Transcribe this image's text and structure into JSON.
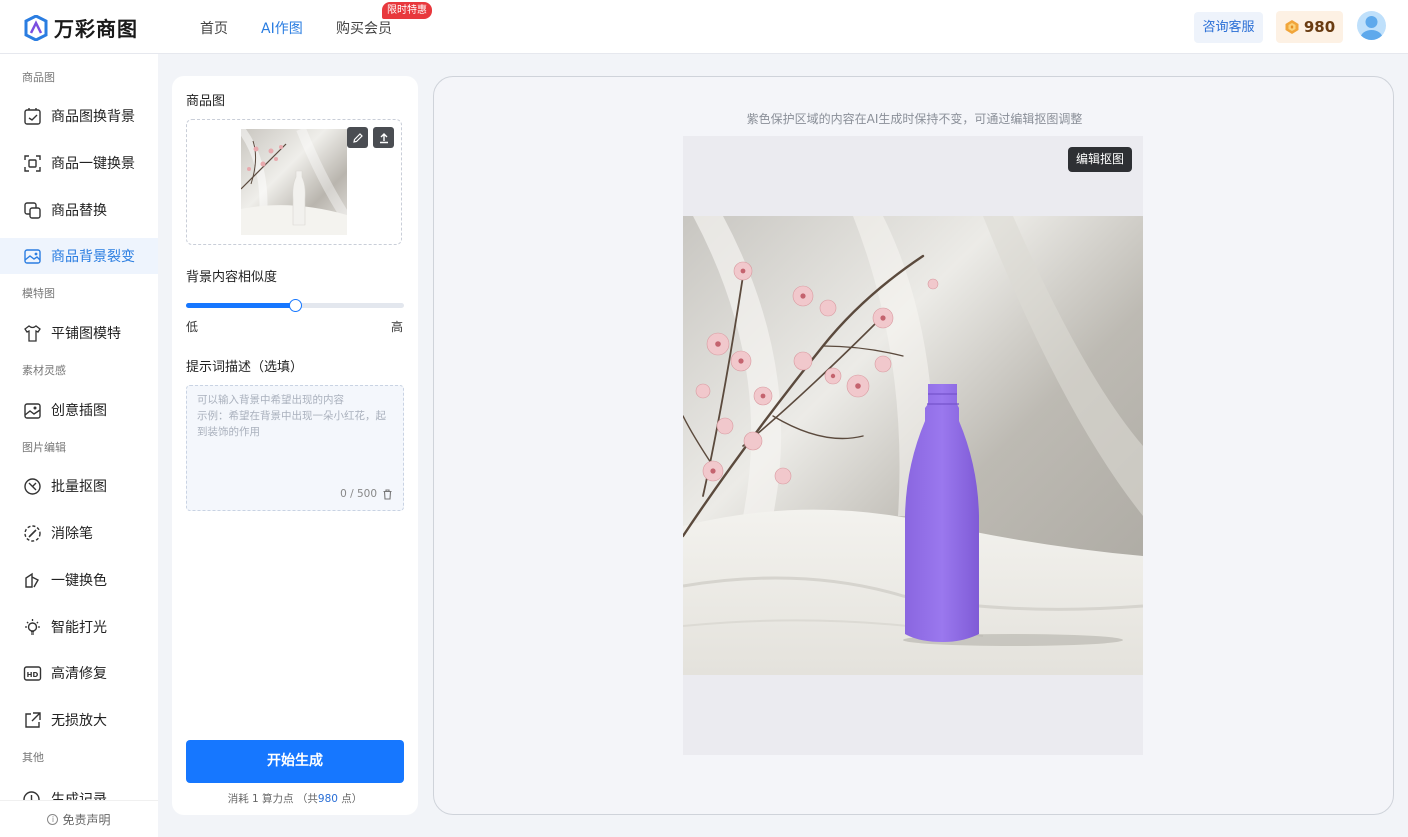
{
  "header": {
    "logo_text": "万彩商图",
    "nav": [
      {
        "label": "首页"
      },
      {
        "label": "AI作图"
      },
      {
        "label": "购买会员"
      }
    ],
    "nav_badge": "限时特惠",
    "consult_label": "咨询客服",
    "points": "980"
  },
  "sidebar": {
    "groups": {
      "g1": "商品图",
      "g2": "模特图",
      "g3": "素材灵感",
      "g4": "图片编辑",
      "g5": "其他"
    },
    "items": [
      {
        "label": "商品图换背景",
        "icon": "image-swap-icon"
      },
      {
        "label": "商品一键换景",
        "icon": "scene-swap-icon"
      },
      {
        "label": "商品替换",
        "icon": "product-replace-icon"
      },
      {
        "label": "商品背景裂变",
        "icon": "background-variant-icon"
      },
      {
        "label": "平铺图模特",
        "icon": "shirt-model-icon"
      },
      {
        "label": "创意插图",
        "icon": "creative-image-icon"
      },
      {
        "label": "批量抠图",
        "icon": "batch-cutout-icon"
      },
      {
        "label": "消除笔",
        "icon": "eraser-pen-icon"
      },
      {
        "label": "一键换色",
        "icon": "recolor-icon"
      },
      {
        "label": "智能打光",
        "icon": "lightbulb-icon"
      },
      {
        "label": "高清修复",
        "icon": "hd-icon"
      },
      {
        "label": "无损放大",
        "icon": "upscale-icon"
      },
      {
        "label": "生成记录",
        "icon": "history-icon"
      }
    ],
    "footer": "免责声明"
  },
  "panel": {
    "product_label": "商品图",
    "similarity_label": "背景内容相似度",
    "similarity_value": 0.5,
    "slider_low": "低",
    "slider_high": "高",
    "prompt_label": "提示词描述（选填）",
    "prompt_placeholder_line1": "可以输入背景中希望出现的内容",
    "prompt_placeholder_line2": "示例：希望在背景中出现一朵小红花，起到装饰的作用",
    "prompt_count": "0 / 500",
    "generate_label": "开始生成",
    "cost_prefix": "消耗 1 算力点  （共",
    "cost_num": "980",
    "cost_suffix": " 点）"
  },
  "canvas": {
    "hint": "紫色保护区域的内容在AI生成时保持不变，可通过编辑抠图调整",
    "edit_cutout_label": "编辑抠图",
    "protect_color": "#8e6ae3"
  },
  "colors": {
    "primary": "#1677ff",
    "badge": "#e8383d"
  }
}
